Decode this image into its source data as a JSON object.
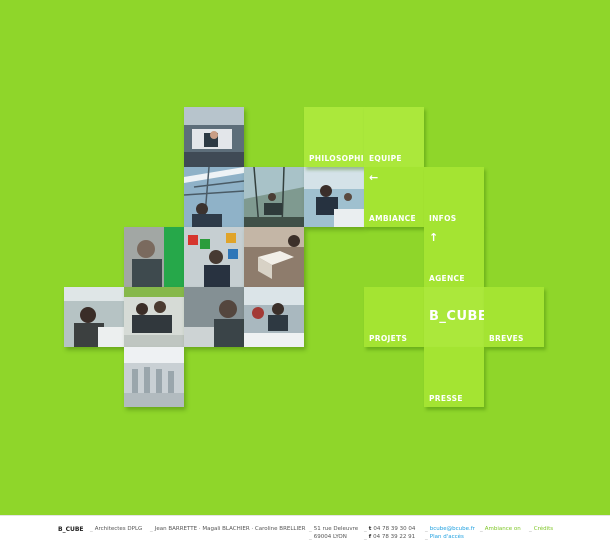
{
  "menu": {
    "philosophie": "PHILOSOPHIE",
    "equipe": "EQUIPE",
    "ambiance": "AMBIANCE",
    "infos": "INFOS",
    "agence": "AGENCE",
    "projets": "PROJETS",
    "brand": "B_CUBE",
    "breves": "BREVES",
    "presse": "PRESSE",
    "arrow_left": "←",
    "arrow_up": "↑"
  },
  "footer": {
    "brand": "B_CUBE",
    "subtitle": "Architectes DPLG",
    "names": "Jean BARRETTE · Magali BLACHIER · Caroline BRELLIER",
    "address_line1": "51 rue Deleuvre",
    "address_line2": "69004 LYON",
    "phone_label": "t",
    "phone": "04 78 39 30 04",
    "fax_label": "f",
    "fax": "04 78 39 22 91",
    "email": "bcube@bcube.fr",
    "map": "Plan d'accès",
    "ambiance_link": "Ambiance on",
    "credits": "Crédits"
  },
  "colors": {
    "background": "#8fd62a",
    "tile": "#a4e432",
    "link": "#1fa0e0",
    "footer_green": "#7ec626"
  }
}
